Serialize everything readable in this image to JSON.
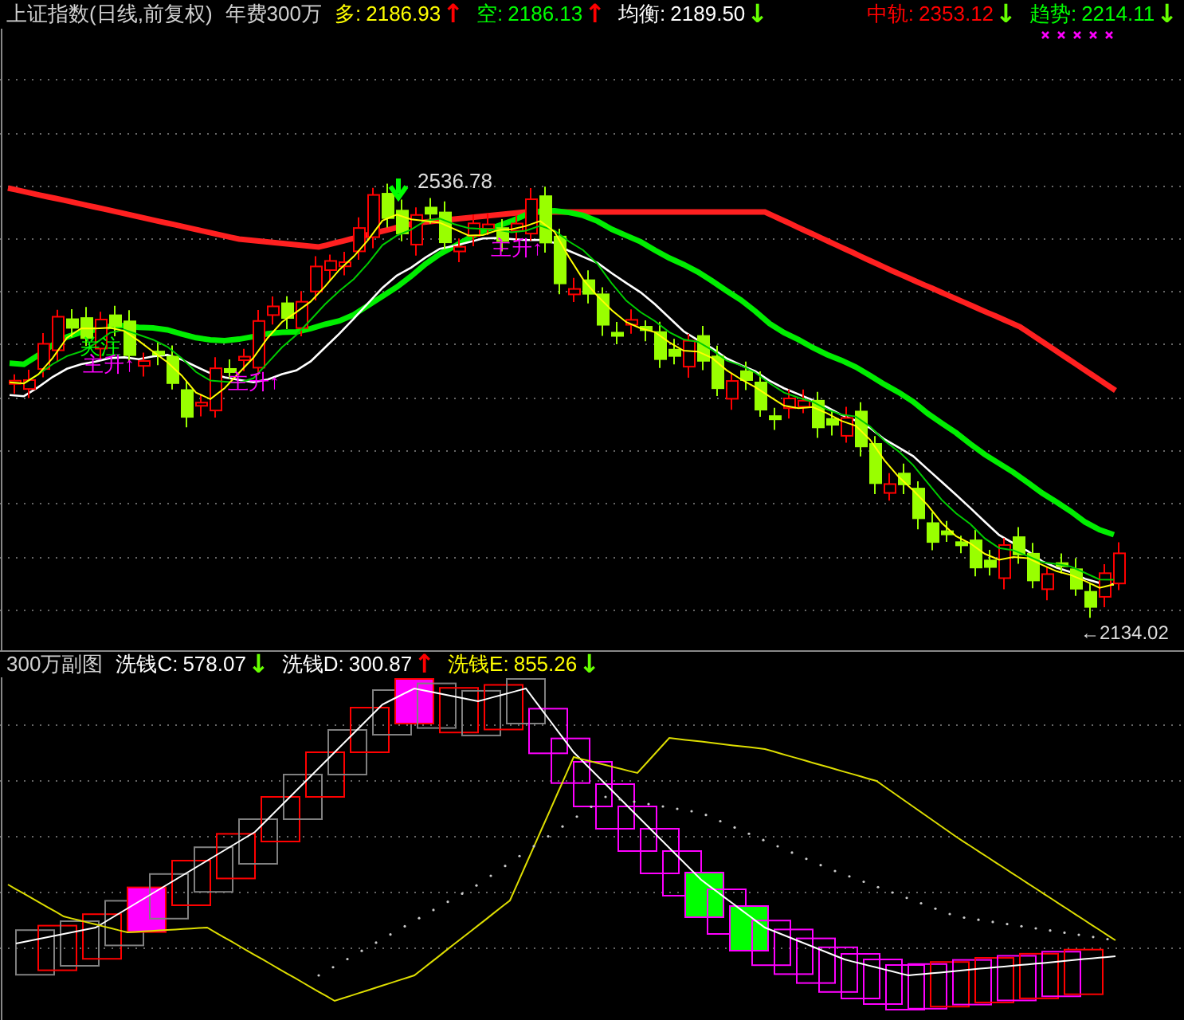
{
  "header": {
    "title": "上证指数(日线,前复权)",
    "subtitle": "年费300万",
    "left_indicators": [
      {
        "label": "多:",
        "value": "2186.93",
        "color": "#ffff00",
        "arrow": {
          "text": "↑",
          "color": "#ff0000"
        }
      },
      {
        "label": "空:",
        "value": "2186.13",
        "color": "#00ff00",
        "arrow": {
          "text": "↑",
          "color": "#ff0000"
        }
      },
      {
        "label": "均衡:",
        "value": "2189.50",
        "color": "#ffffff",
        "arrow": {
          "text": "↓",
          "color": "#66ff00"
        }
      }
    ],
    "right_indicators": [
      {
        "label": "中轨:",
        "value": "2353.12",
        "color": "#ff0000",
        "arrow": {
          "text": "↓",
          "color": "#66ff00"
        }
      },
      {
        "label": "趋势:",
        "value": "2214.11",
        "color": "#00ff00",
        "arrow": {
          "text": "↓",
          "color": "#66ff00"
        }
      }
    ]
  },
  "main_chart": {
    "annotations": [
      {
        "text": "关注",
        "color": "#00ff00"
      },
      {
        "text": "主升↑",
        "color": "#ff00ff"
      },
      {
        "text": "主升↑",
        "color": "#ff00ff"
      },
      {
        "text": "主升↑",
        "color": "#ff00ff"
      }
    ],
    "high_label": "2536.78",
    "low_label": "←2134.02"
  },
  "sub_header": {
    "title": "300万副图",
    "indicators": [
      {
        "label": "洗钱C:",
        "value": "578.07",
        "color": "#ffffff",
        "arrow": {
          "text": "↓",
          "color": "#66ff00"
        }
      },
      {
        "label": "洗钱D:",
        "value": "300.87",
        "color": "#ffffff",
        "arrow": {
          "text": "↑",
          "color": "#ff0000"
        }
      },
      {
        "label": "洗钱E:",
        "value": "855.26",
        "color": "#ffff00",
        "arrow": {
          "text": "↓",
          "color": "#66ff00"
        }
      }
    ]
  }
}
